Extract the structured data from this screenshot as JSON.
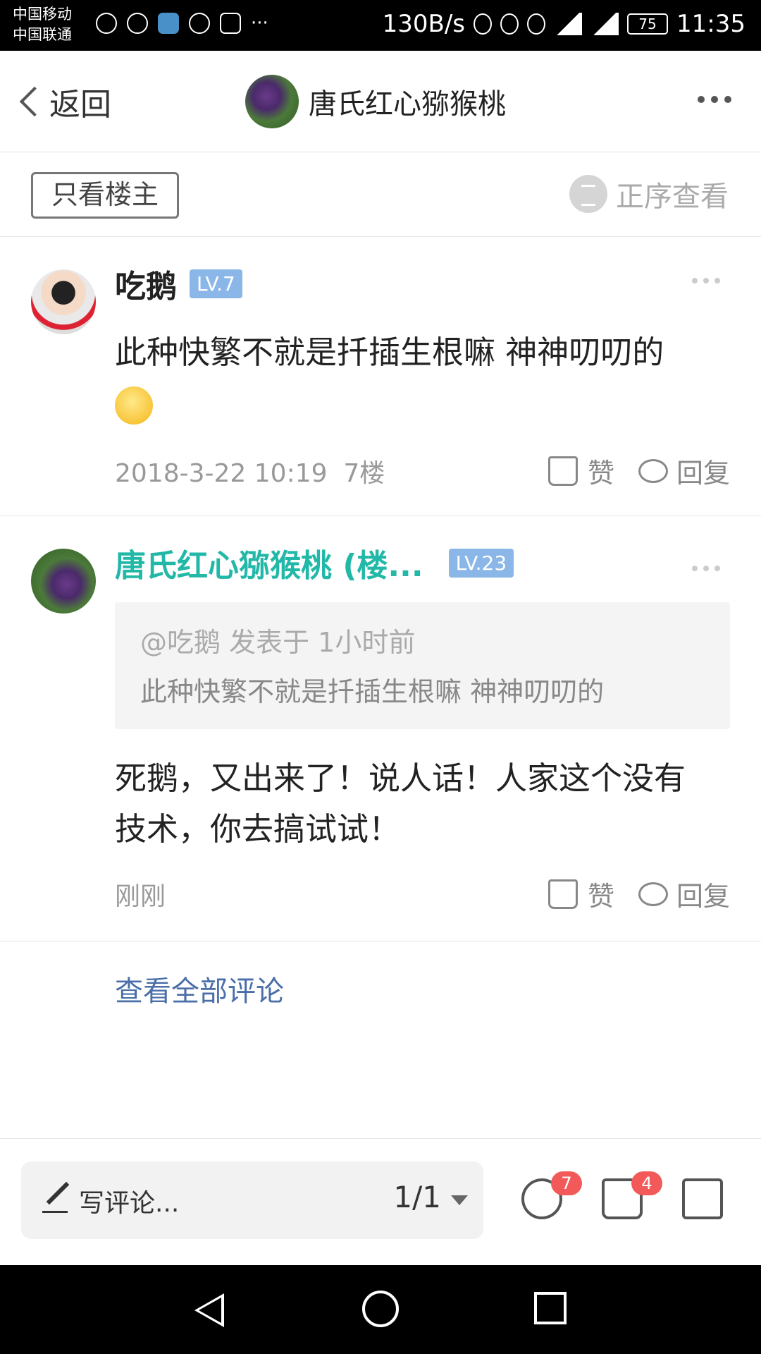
{
  "status_bar": {
    "carrier1": "中国移动",
    "carrier2": "中国联通",
    "speed": "130B/s",
    "battery": "75",
    "time": "11:35",
    "more": "···"
  },
  "nav": {
    "back_label": "返回",
    "title": "唐氏红心猕猴桃"
  },
  "filter": {
    "only_op": "只看楼主",
    "sort_label": "正序查看"
  },
  "posts": [
    {
      "author": "吃鹅",
      "level": "LV.7",
      "content": "此种快繁不就是扦插生根嘛   神神叨叨的",
      "time": "2018-3-22 10:19",
      "floor": "7楼",
      "like_label": "赞",
      "reply_label": "回复"
    },
    {
      "author": "唐氏红心猕猴桃 (楼...",
      "level": "LV.23",
      "quote_header": "@吃鹅 发表于 1小时前",
      "quote_text": "此种快繁不就是扦插生根嘛   神神叨叨的",
      "content_line1": "死鹅，又出来了！说人话！人家这个没有",
      "content_line2": "技术，你去搞试试！",
      "time": "刚刚",
      "like_label": "赞",
      "reply_label": "回复"
    }
  ],
  "view_all": "查看全部评论",
  "bottom_bar": {
    "comment_placeholder": "写评论...",
    "page_indicator": "1/1",
    "comment_count": "7",
    "like_count": "4"
  }
}
